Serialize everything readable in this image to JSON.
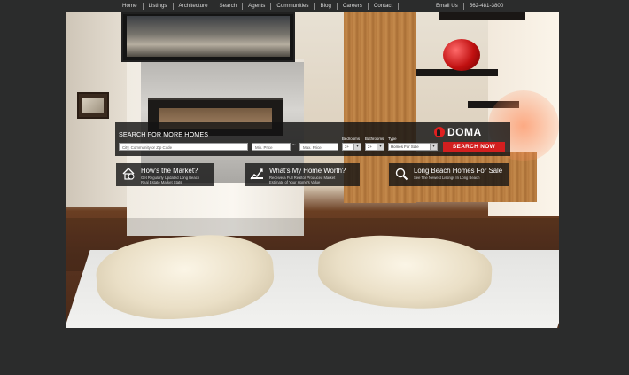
{
  "nav": {
    "links": [
      "Home",
      "Listings",
      "Architecture",
      "Search",
      "Agents",
      "Communities",
      "Blog",
      "Careers",
      "Contact"
    ],
    "email_label": "Email Us",
    "phone": "562-481-3800"
  },
  "search": {
    "heading": "SEARCH FOR MORE HOMES",
    "location_placeholder": "City, Community or Zip Code",
    "min_price_placeholder": "Min. Price",
    "price_separator": "~",
    "max_price_placeholder": "Max. Price",
    "bedrooms_label": "Bedrooms",
    "bedrooms_value": "3+",
    "bathrooms_label": "Bathrooms",
    "bathrooms_value": "2+",
    "type_label": "Type",
    "type_value": "Homes For Sale",
    "submit_label": "SEARCH NOW"
  },
  "brand": {
    "name": "DOMA",
    "accent": "#d21f1f"
  },
  "cards": [
    {
      "icon": "house-icon",
      "title": "How's the Market?",
      "subtitle_1": "Get Regularly Updated Long Beach",
      "subtitle_2": "Real Estate Market Stats"
    },
    {
      "icon": "chart-icon",
      "title": "What's My Home Worth?",
      "subtitle_1": "Receive a Full Realtor Produced Market",
      "subtitle_2": "Estimate of Your Home's Value"
    },
    {
      "icon": "magnifier-icon",
      "title": "Long Beach Homes For Sale",
      "subtitle_1": "See The Newest Listings In Long Beach",
      "subtitle_2": ""
    }
  ]
}
